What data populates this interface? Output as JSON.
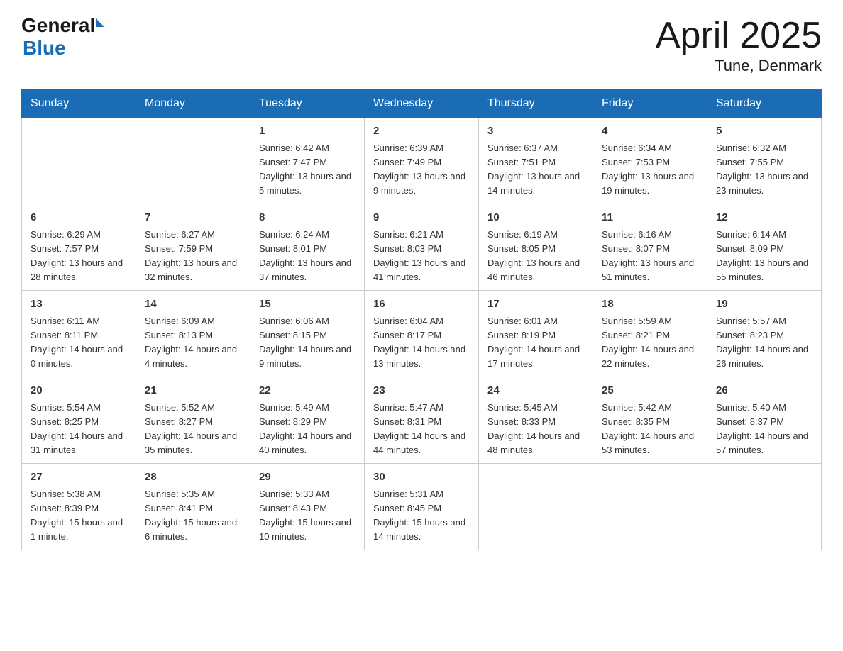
{
  "header": {
    "logo_general": "General",
    "logo_blue": "Blue",
    "month_title": "April 2025",
    "location": "Tune, Denmark"
  },
  "weekdays": [
    "Sunday",
    "Monday",
    "Tuesday",
    "Wednesday",
    "Thursday",
    "Friday",
    "Saturday"
  ],
  "weeks": [
    [
      {
        "day": "",
        "sunrise": "",
        "sunset": "",
        "daylight": ""
      },
      {
        "day": "",
        "sunrise": "",
        "sunset": "",
        "daylight": ""
      },
      {
        "day": "1",
        "sunrise": "Sunrise: 6:42 AM",
        "sunset": "Sunset: 7:47 PM",
        "daylight": "Daylight: 13 hours and 5 minutes."
      },
      {
        "day": "2",
        "sunrise": "Sunrise: 6:39 AM",
        "sunset": "Sunset: 7:49 PM",
        "daylight": "Daylight: 13 hours and 9 minutes."
      },
      {
        "day": "3",
        "sunrise": "Sunrise: 6:37 AM",
        "sunset": "Sunset: 7:51 PM",
        "daylight": "Daylight: 13 hours and 14 minutes."
      },
      {
        "day": "4",
        "sunrise": "Sunrise: 6:34 AM",
        "sunset": "Sunset: 7:53 PM",
        "daylight": "Daylight: 13 hours and 19 minutes."
      },
      {
        "day": "5",
        "sunrise": "Sunrise: 6:32 AM",
        "sunset": "Sunset: 7:55 PM",
        "daylight": "Daylight: 13 hours and 23 minutes."
      }
    ],
    [
      {
        "day": "6",
        "sunrise": "Sunrise: 6:29 AM",
        "sunset": "Sunset: 7:57 PM",
        "daylight": "Daylight: 13 hours and 28 minutes."
      },
      {
        "day": "7",
        "sunrise": "Sunrise: 6:27 AM",
        "sunset": "Sunset: 7:59 PM",
        "daylight": "Daylight: 13 hours and 32 minutes."
      },
      {
        "day": "8",
        "sunrise": "Sunrise: 6:24 AM",
        "sunset": "Sunset: 8:01 PM",
        "daylight": "Daylight: 13 hours and 37 minutes."
      },
      {
        "day": "9",
        "sunrise": "Sunrise: 6:21 AM",
        "sunset": "Sunset: 8:03 PM",
        "daylight": "Daylight: 13 hours and 41 minutes."
      },
      {
        "day": "10",
        "sunrise": "Sunrise: 6:19 AM",
        "sunset": "Sunset: 8:05 PM",
        "daylight": "Daylight: 13 hours and 46 minutes."
      },
      {
        "day": "11",
        "sunrise": "Sunrise: 6:16 AM",
        "sunset": "Sunset: 8:07 PM",
        "daylight": "Daylight: 13 hours and 51 minutes."
      },
      {
        "day": "12",
        "sunrise": "Sunrise: 6:14 AM",
        "sunset": "Sunset: 8:09 PM",
        "daylight": "Daylight: 13 hours and 55 minutes."
      }
    ],
    [
      {
        "day": "13",
        "sunrise": "Sunrise: 6:11 AM",
        "sunset": "Sunset: 8:11 PM",
        "daylight": "Daylight: 14 hours and 0 minutes."
      },
      {
        "day": "14",
        "sunrise": "Sunrise: 6:09 AM",
        "sunset": "Sunset: 8:13 PM",
        "daylight": "Daylight: 14 hours and 4 minutes."
      },
      {
        "day": "15",
        "sunrise": "Sunrise: 6:06 AM",
        "sunset": "Sunset: 8:15 PM",
        "daylight": "Daylight: 14 hours and 9 minutes."
      },
      {
        "day": "16",
        "sunrise": "Sunrise: 6:04 AM",
        "sunset": "Sunset: 8:17 PM",
        "daylight": "Daylight: 14 hours and 13 minutes."
      },
      {
        "day": "17",
        "sunrise": "Sunrise: 6:01 AM",
        "sunset": "Sunset: 8:19 PM",
        "daylight": "Daylight: 14 hours and 17 minutes."
      },
      {
        "day": "18",
        "sunrise": "Sunrise: 5:59 AM",
        "sunset": "Sunset: 8:21 PM",
        "daylight": "Daylight: 14 hours and 22 minutes."
      },
      {
        "day": "19",
        "sunrise": "Sunrise: 5:57 AM",
        "sunset": "Sunset: 8:23 PM",
        "daylight": "Daylight: 14 hours and 26 minutes."
      }
    ],
    [
      {
        "day": "20",
        "sunrise": "Sunrise: 5:54 AM",
        "sunset": "Sunset: 8:25 PM",
        "daylight": "Daylight: 14 hours and 31 minutes."
      },
      {
        "day": "21",
        "sunrise": "Sunrise: 5:52 AM",
        "sunset": "Sunset: 8:27 PM",
        "daylight": "Daylight: 14 hours and 35 minutes."
      },
      {
        "day": "22",
        "sunrise": "Sunrise: 5:49 AM",
        "sunset": "Sunset: 8:29 PM",
        "daylight": "Daylight: 14 hours and 40 minutes."
      },
      {
        "day": "23",
        "sunrise": "Sunrise: 5:47 AM",
        "sunset": "Sunset: 8:31 PM",
        "daylight": "Daylight: 14 hours and 44 minutes."
      },
      {
        "day": "24",
        "sunrise": "Sunrise: 5:45 AM",
        "sunset": "Sunset: 8:33 PM",
        "daylight": "Daylight: 14 hours and 48 minutes."
      },
      {
        "day": "25",
        "sunrise": "Sunrise: 5:42 AM",
        "sunset": "Sunset: 8:35 PM",
        "daylight": "Daylight: 14 hours and 53 minutes."
      },
      {
        "day": "26",
        "sunrise": "Sunrise: 5:40 AM",
        "sunset": "Sunset: 8:37 PM",
        "daylight": "Daylight: 14 hours and 57 minutes."
      }
    ],
    [
      {
        "day": "27",
        "sunrise": "Sunrise: 5:38 AM",
        "sunset": "Sunset: 8:39 PM",
        "daylight": "Daylight: 15 hours and 1 minute."
      },
      {
        "day": "28",
        "sunrise": "Sunrise: 5:35 AM",
        "sunset": "Sunset: 8:41 PM",
        "daylight": "Daylight: 15 hours and 6 minutes."
      },
      {
        "day": "29",
        "sunrise": "Sunrise: 5:33 AM",
        "sunset": "Sunset: 8:43 PM",
        "daylight": "Daylight: 15 hours and 10 minutes."
      },
      {
        "day": "30",
        "sunrise": "Sunrise: 5:31 AM",
        "sunset": "Sunset: 8:45 PM",
        "daylight": "Daylight: 15 hours and 14 minutes."
      },
      {
        "day": "",
        "sunrise": "",
        "sunset": "",
        "daylight": ""
      },
      {
        "day": "",
        "sunrise": "",
        "sunset": "",
        "daylight": ""
      },
      {
        "day": "",
        "sunrise": "",
        "sunset": "",
        "daylight": ""
      }
    ]
  ]
}
